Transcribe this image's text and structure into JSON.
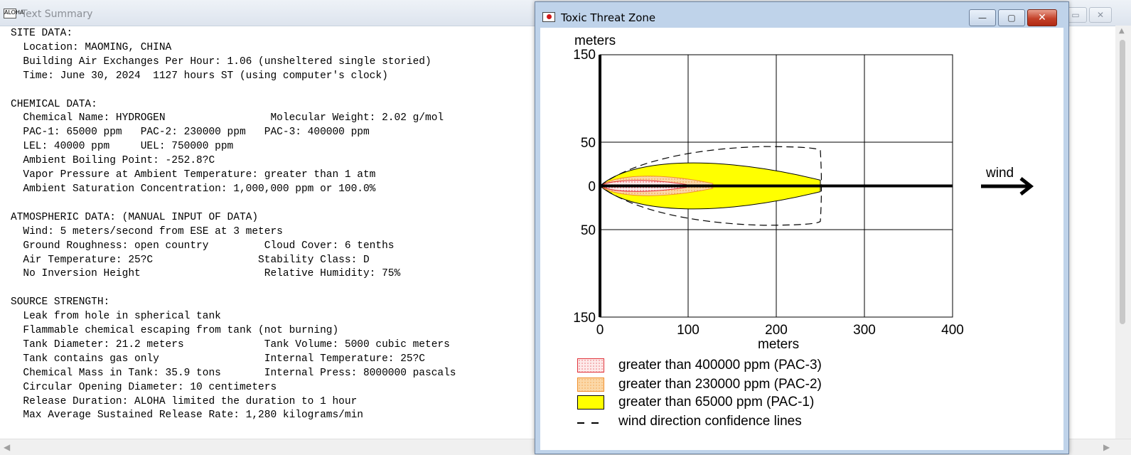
{
  "summary_window": {
    "title": "Text Summary",
    "app_icon": "ALOHA",
    "controls": {
      "restore": "▭",
      "close": "✕"
    },
    "lines": [
      "SITE DATA:",
      "  Location: MAOMING, CHINA",
      "  Building Air Exchanges Per Hour: 1.06 (unsheltered single storied)",
      "  Time: June 30, 2024  1127 hours ST (using computer's clock)",
      "",
      "CHEMICAL DATA:",
      "  Chemical Name: HYDROGEN                 Molecular Weight: 2.02 g/mol",
      "  PAC-1: 65000 ppm   PAC-2: 230000 ppm   PAC-3: 400000 ppm",
      "  LEL: 40000 ppm     UEL: 750000 ppm",
      "  Ambient Boiling Point: -252.8?C",
      "  Vapor Pressure at Ambient Temperature: greater than 1 atm",
      "  Ambient Saturation Concentration: 1,000,000 ppm or 100.0%",
      "",
      "ATMOSPHERIC DATA: (MANUAL INPUT OF DATA)",
      "  Wind: 5 meters/second from ESE at 3 meters",
      "  Ground Roughness: open country         Cloud Cover: 6 tenths",
      "  Air Temperature: 25?C                 Stability Class: D",
      "  No Inversion Height                    Relative Humidity: 75%",
      "",
      "SOURCE STRENGTH:",
      "  Leak from hole in spherical tank",
      "  Flammable chemical escaping from tank (not burning)",
      "  Tank Diameter: 21.2 meters             Tank Volume: 5000 cubic meters",
      "  Tank contains gas only                 Internal Temperature: 25?C",
      "  Chemical Mass in Tank: 35.9 tons       Internal Press: 8000000 pascals",
      "  Circular Opening Diameter: 10 centimeters",
      "  Release Duration: ALOHA limited the duration to 1 hour",
      "  Max Average Sustained Release Rate: 1,280 kilograms/min"
    ],
    "scroll_left": "◀",
    "scroll_right": "▶",
    "scroll_up": "▲"
  },
  "threat_window": {
    "title": "Toxic Threat Zone",
    "controls": {
      "minimize": "—",
      "maximize": "▢",
      "close": "✕"
    },
    "wind_label": "wind"
  },
  "chart_data": {
    "type": "area",
    "xlabel": "meters",
    "ylabel": "meters",
    "xlim": [
      0,
      400
    ],
    "ylim": [
      -150,
      150
    ],
    "x_ticks": [
      "0",
      "100",
      "200",
      "300",
      "400"
    ],
    "y_ticks": [
      "150",
      "50",
      "0",
      "50",
      "150"
    ],
    "y_tick_values": [
      150,
      50,
      0,
      -50,
      -150
    ],
    "grid": true,
    "zones": [
      {
        "name": "greater than 400000 ppm (PAC-3)",
        "length_m": 98,
        "half_width_m": 8,
        "fill": "#fdeaea",
        "stroke": "#e0323a",
        "pattern": "dots"
      },
      {
        "name": "greater than 230000 ppm (PAC-2)",
        "length_m": 128,
        "half_width_m": 14,
        "fill": "#fbd8a8",
        "stroke": "#f08c2a",
        "pattern": "dots"
      },
      {
        "name": "greater than 65000 ppm (PAC-1)",
        "length_m": 250,
        "half_width_m": 33,
        "fill": "#ffff00",
        "stroke": "#000000",
        "pattern": "solid"
      }
    ],
    "confidence_lines": {
      "name": "wind direction confidence lines",
      "max_x_m": 250,
      "max_half_width_m": 45,
      "style": "dashed"
    },
    "wind_direction": "east"
  }
}
